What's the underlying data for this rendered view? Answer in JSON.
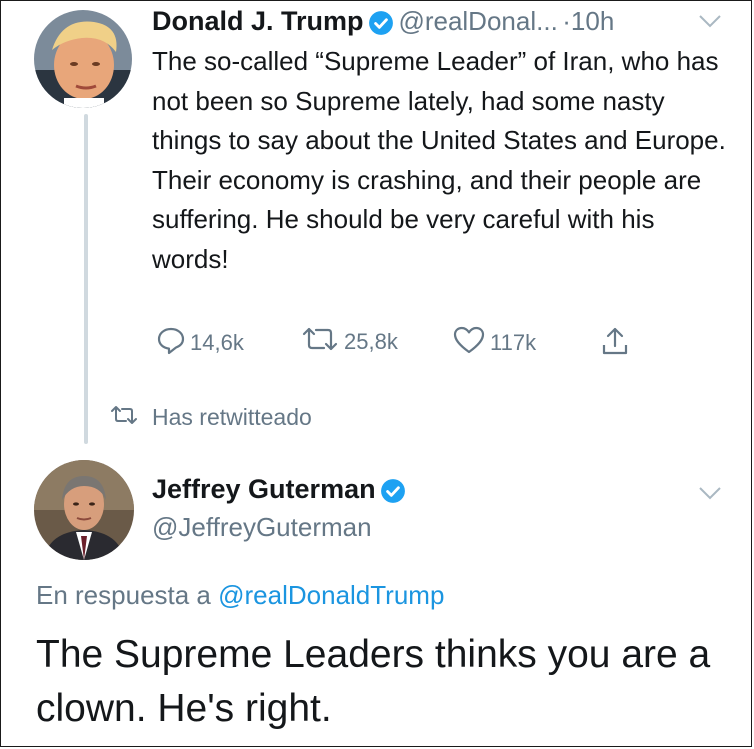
{
  "tweet1": {
    "name": "Donald J. Trump",
    "handle": "@realDonal...",
    "separator": "·",
    "time": "10h",
    "text": "The so-called “Supreme Leader” of Iran, who has not been so Supreme lately, had some nasty things to say about the United States and Europe. Their economy is crashing, and their people are suffering. He should be very careful with his words!",
    "replies": "14,6k",
    "retweets": "25,8k",
    "likes": "117k"
  },
  "retweet_status": "Has retwitteado",
  "tweet2": {
    "name": "Jeffrey Guterman",
    "handle": "@JeffreyGuterman",
    "reply_prefix": "En respuesta a",
    "reply_mention": "@realDonaldTrump",
    "text": "The Supreme Leaders thinks you are a clown. He's right."
  },
  "colors": {
    "verified": "#1da1f2",
    "muted": "#657786",
    "link": "#1b95e0"
  }
}
